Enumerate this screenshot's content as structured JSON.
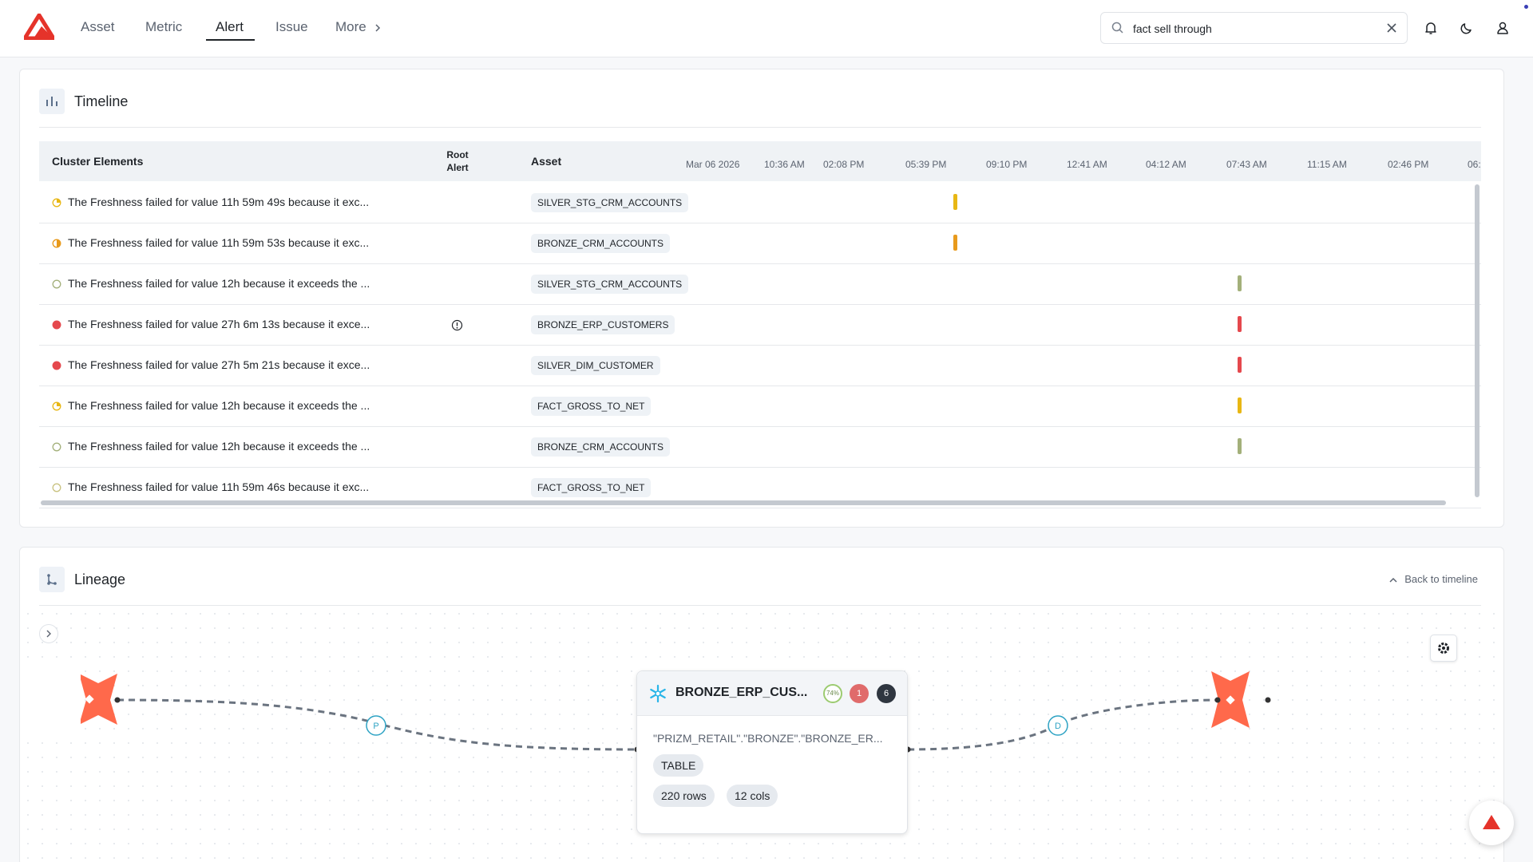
{
  "nav": {
    "items": [
      "Asset",
      "Metric",
      "Alert",
      "Issue",
      "More"
    ],
    "active": "Alert"
  },
  "search": {
    "value": "fact sell through",
    "placeholder": ""
  },
  "timeline": {
    "title": "Timeline",
    "columns": {
      "cluster": "Cluster Elements",
      "root_line1": "Root",
      "root_line2": "Alert",
      "asset": "Asset"
    },
    "ticks": [
      "Mar 06 2026",
      "10:36 AM",
      "02:08 PM",
      "05:39 PM",
      "09:10 PM",
      "12:41 AM",
      "04:12 AM",
      "07:43 AM",
      "11:15 AM",
      "02:46 PM",
      "06:"
    ],
    "rows": [
      {
        "text": "The Freshness failed for value 11h 59m 49s because it exc...",
        "asset": "SILVER_STG_CRM_ACCOUNTS",
        "status_color": "#e8b714",
        "status_fill": 0.25,
        "bar_color": "#e8b714",
        "root": false
      },
      {
        "text": "The Freshness failed for value 11h 59m 53s because it exc...",
        "asset": "BRONZE_CRM_ACCOUNTS",
        "status_color": "#e89a1c",
        "status_fill": 0.5,
        "bar_color": "#e89a1c",
        "root": false
      },
      {
        "text": "The Freshness failed for value 12h because it exceeds the ...",
        "asset": "SILVER_STG_CRM_ACCOUNTS",
        "status_color": "#a3b07a",
        "status_fill": 0,
        "bar_color": "#a3b07a",
        "root": false
      },
      {
        "text": "The Freshness failed for value 27h 6m 13s because it exce...",
        "asset": "BRONZE_ERP_CUSTOMERS",
        "status_color": "#e5484d",
        "status_fill": 1,
        "bar_color": "#e5484d",
        "root": true
      },
      {
        "text": "The Freshness failed for value 27h 5m 21s because it exce...",
        "asset": "SILVER_DIM_CUSTOMER",
        "status_color": "#e5484d",
        "status_fill": 1,
        "bar_color": "#e5484d",
        "root": false
      },
      {
        "text": "The Freshness failed for value 12h because it exceeds the ...",
        "asset": "FACT_GROSS_TO_NET",
        "status_color": "#e8b714",
        "status_fill": 0.25,
        "bar_color": "#e8b714",
        "root": false
      },
      {
        "text": "The Freshness failed for value 12h because it exceeds the ...",
        "asset": "BRONZE_CRM_ACCOUNTS",
        "status_color": "#a3b07a",
        "status_fill": 0,
        "bar_color": "#a3b07a",
        "root": false
      },
      {
        "text": "The Freshness failed for value 11h 59m 46s because it exc...",
        "asset": "FACT_GROSS_TO_NET",
        "status_color": "#c9c280",
        "status_fill": 0,
        "bar_color": "",
        "root": false
      }
    ]
  },
  "lineage": {
    "title": "Lineage",
    "back_label": "Back to timeline",
    "left_edge_label": "P",
    "right_edge_label": "D",
    "node": {
      "title": "BRONZE_ERP_CUS...",
      "score": "74%",
      "alerts": "1",
      "issues": "6",
      "path": "\"PRIZM_RETAIL\".\"BRONZE\".\"BRONZE_ER...",
      "type": "TABLE",
      "rows": "220 rows",
      "cols": "12 cols"
    }
  },
  "colors": {
    "brand": "#e5332a",
    "dbt": "#ff694b",
    "snowflake": "#29b5e8",
    "accent": "#1f2328"
  }
}
